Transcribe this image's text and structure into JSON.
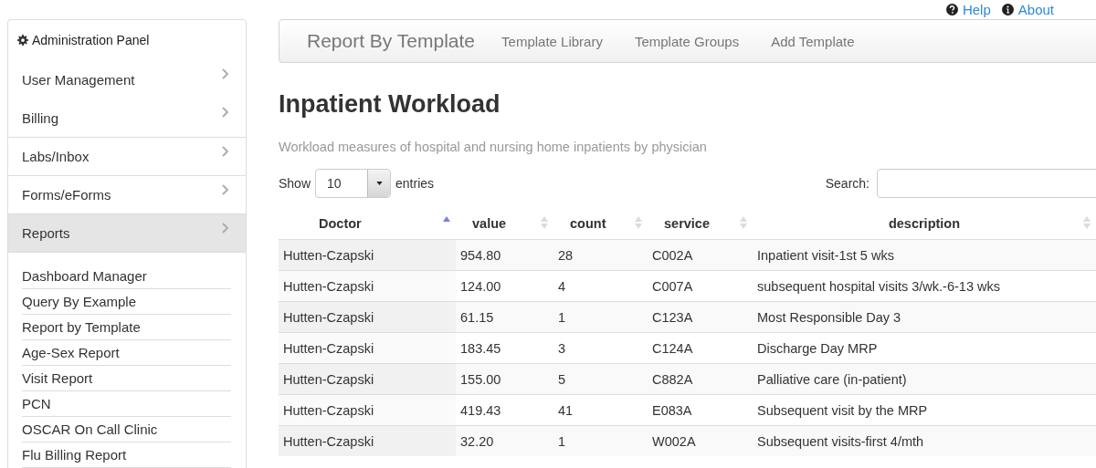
{
  "top_links": [
    {
      "kind": "help",
      "label": "Help"
    },
    {
      "kind": "about",
      "label": "About"
    }
  ],
  "sidebar": {
    "title": "Administration Panel",
    "items": [
      {
        "label": "User Management",
        "selected": false
      },
      {
        "label": "Billing",
        "selected": false
      },
      {
        "label": "Labs/Inbox",
        "selected": false
      },
      {
        "label": "Forms/eForms",
        "selected": false
      },
      {
        "label": "Reports",
        "selected": true
      }
    ],
    "submenu": [
      "Dashboard Manager",
      "Query By Example",
      "Report by Template",
      "Age-Sex Report",
      "Visit Report",
      "PCN",
      "OSCAR On Call Clinic",
      "Flu Billing Report"
    ]
  },
  "navbar": {
    "brand": "Report By Template",
    "links": [
      "Template Library",
      "Template Groups",
      "Add Template"
    ]
  },
  "page_title": "Inpatient Workload",
  "description": "Workload measures of hospital and nursing home inpatients by physician",
  "length": {
    "before": "Show",
    "value": "10",
    "after": "entries"
  },
  "search": {
    "label": "Search:"
  },
  "table": {
    "columns": [
      {
        "label": "Doctor",
        "sorted": true
      },
      {
        "label": "value",
        "sorted": false
      },
      {
        "label": "count",
        "sorted": false
      },
      {
        "label": "service",
        "sorted": false
      },
      {
        "label": "description",
        "sorted": false
      }
    ],
    "rows": [
      [
        "Hutten-Czapski",
        "954.80",
        "28",
        "C002A",
        "Inpatient visit-1st 5 wks"
      ],
      [
        "Hutten-Czapski",
        "124.00",
        "4",
        "C007A",
        "subsequent hospital visits 3/wk.-6-13 wks"
      ],
      [
        "Hutten-Czapski",
        "61.15",
        "1",
        "C123A",
        "Most Responsible Day 3"
      ],
      [
        "Hutten-Czapski",
        "183.45",
        "3",
        "C124A",
        "Discharge Day MRP"
      ],
      [
        "Hutten-Czapski",
        "155.00",
        "5",
        "C882A",
        "Palliative care (in-patient)"
      ],
      [
        "Hutten-Czapski",
        "419.43",
        "41",
        "E083A",
        "Subsequent visit by the MRP"
      ],
      [
        "Hutten-Czapski",
        "32.20",
        "1",
        "W002A",
        "Subsequent visits-first 4/mth"
      ]
    ]
  }
}
